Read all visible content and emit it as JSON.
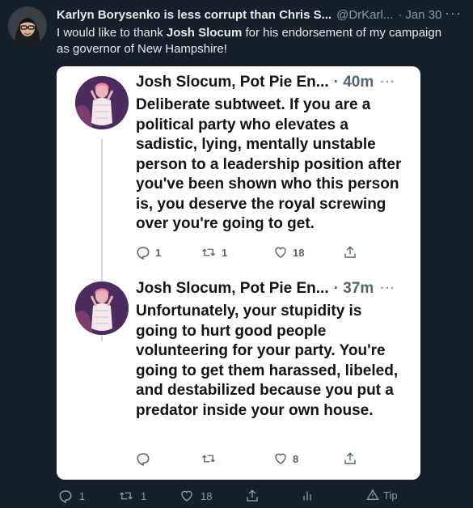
{
  "outer_tweet": {
    "author_name": "Karlyn Borysenko is less corrupt than Chris S...",
    "handle": "@DrKarl...",
    "separator": "·",
    "time": "Jan 30",
    "text_before": "I would like to thank ",
    "text_bold": "Josh Slocum",
    "text_after": " for his endorsement of my campaign as governor of New Hampshire!",
    "more_label": "···"
  },
  "quoted_thread": [
    {
      "author_name": "Josh Slocum, Pot Pie En...",
      "time": "· 40m",
      "more_label": "···",
      "text": "Deliberate subtweet. If you are a political party who elevates a sadistic, lying, mentally unstable person to a leadership position after you've been shown who this person is, you deserve the royal screwing over you're going to get.",
      "replies": "1",
      "retweets": "1",
      "likes": "18",
      "reply_icon": "reply-icon",
      "retweet_icon": "retweet-icon",
      "like_icon": "heart-icon",
      "share_icon": "share-icon"
    },
    {
      "author_name": "Josh Slocum, Pot Pie En...",
      "time": "· 37m",
      "more_label": "···",
      "text": "Unfortunately, your stupidity is going to hurt good people volunteering for your party. You're going to get them harassed, libeled, and destabilized because you put a predator inside your own house.",
      "replies": "",
      "retweets": "",
      "likes": "8",
      "reply_icon": "reply-icon",
      "retweet_icon": "retweet-icon",
      "like_icon": "heart-icon",
      "share_icon": "share-icon"
    }
  ],
  "outer_actions": {
    "replies": "1",
    "retweets": "1",
    "likes": "18",
    "tip_label": "Tip"
  },
  "colors": {
    "background": "#15202b",
    "card": "#ffffff",
    "muted": "#8b98a5",
    "text_dark": "#0f1419"
  }
}
